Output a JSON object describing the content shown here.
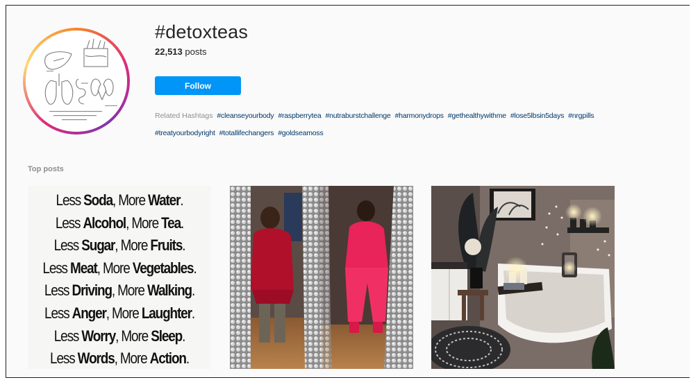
{
  "hashtag": {
    "title": "#detoxteas",
    "post_count": "22,513",
    "post_count_suffix": " posts",
    "follow_label": "Follow"
  },
  "related": {
    "label": "Related Hashtags",
    "tags": [
      "#cleanseyourbody",
      "#raspberrytea",
      "#nutraburstchallenge",
      "#harmonydrops",
      "#gethealthywithme",
      "#lose5lbsin5days",
      "#nrgpills",
      "#treatyourbodyright",
      "#totallifechangers",
      "#goldseamoss"
    ]
  },
  "top_posts": {
    "label": "Top posts",
    "quote_lines": [
      {
        "a": "Less ",
        "b": "Soda",
        "c": ", More ",
        "d": "Water",
        "e": "."
      },
      {
        "a": "Less ",
        "b": "Alcohol",
        "c": ", More ",
        "d": "Tea",
        "e": "."
      },
      {
        "a": "Less ",
        "b": "Sugar",
        "c": ", More ",
        "d": "Fruits",
        "e": "."
      },
      {
        "a": "Less ",
        "b": "Meat",
        "c": ", More ",
        "d": "Vegetables",
        "e": "."
      },
      {
        "a": "Less ",
        "b": "Driving",
        "c": ", More ",
        "d": "Walking",
        "e": "."
      },
      {
        "a": "Less ",
        "b": "Anger",
        "c": ", More ",
        "d": "Laughter",
        "e": "."
      },
      {
        "a": "Less ",
        "b": "Worry",
        "c": ", More ",
        "d": "Sleep",
        "e": "."
      },
      {
        "a": "Less ",
        "b": "Words",
        "c": ", More ",
        "d": "Action",
        "e": "."
      }
    ]
  },
  "colors": {
    "follow_button": "#0095f6",
    "hashtag_link": "#00376b",
    "muted_text": "#8e8e8e"
  }
}
